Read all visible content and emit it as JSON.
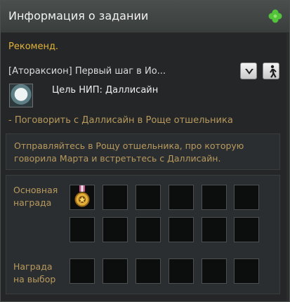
{
  "window": {
    "title": "Информация о задании",
    "icon": "clover-icon"
  },
  "quest": {
    "section_label": "Рекоменд.",
    "title": "[Атораксион] Первый шаг в Йо...",
    "npc_label": "Цель НИП: Даллисайн",
    "task": "- Поговорить с Даллисайн в Роще отшельника",
    "description": "Отправляйтесь в Рощу отшельника, про которую говорила Марта и встретьтесь с Даллисайн.",
    "buttons": {
      "collapse": "chevron-down-icon",
      "navigate": "walking-person-icon"
    }
  },
  "rewards": {
    "main_label": "Основная награда",
    "choice_label": "Награда на выбор",
    "main_items": [
      "medal-icon"
    ],
    "main_slot_count": 12,
    "choice_slot_count": 6
  },
  "colors": {
    "accent_gold": "#e3b33a",
    "text_tan": "#b99a5e",
    "clover_green": "#52c33a"
  }
}
